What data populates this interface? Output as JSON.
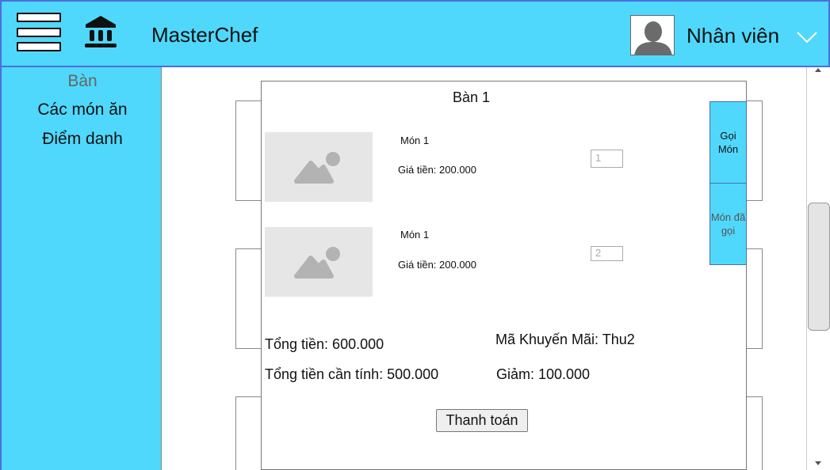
{
  "header": {
    "brand": "MasterChef",
    "user_label": "Nhân viên",
    "icons": [
      "hamburger-icon",
      "bank-icon",
      "user-avatar-icon",
      "caret-down-icon"
    ]
  },
  "sidebar": {
    "items": [
      {
        "label": "Bàn",
        "active": true
      },
      {
        "label": "Các món ăn",
        "active": false
      },
      {
        "label": "Điểm danh",
        "active": false
      }
    ]
  },
  "dialog": {
    "title": "Bàn 1",
    "dishes": [
      {
        "name": "Món 1",
        "price_text": "Giá tiền: 200.000",
        "qty_placeholder": "1"
      },
      {
        "name": "Món 1",
        "price_text": "Giá tiền: 200.000",
        "qty_placeholder": "2"
      }
    ],
    "tabs": {
      "order": "Gọi Món",
      "ordered": "Món đã gọi"
    },
    "summary": {
      "total": "Tổng tiền: 600.000",
      "total_payable": "Tổng tiền cần tính: 500.000",
      "promo": "Mã Khuyến Mãi: Thu2",
      "discount": "Giảm: 100.000"
    },
    "pay_button": "Thanh toán"
  },
  "colors": {
    "accent": "#4fd8fc",
    "header_border": "#4a6fe0",
    "placeholder_gray": "#e6e6e6"
  }
}
